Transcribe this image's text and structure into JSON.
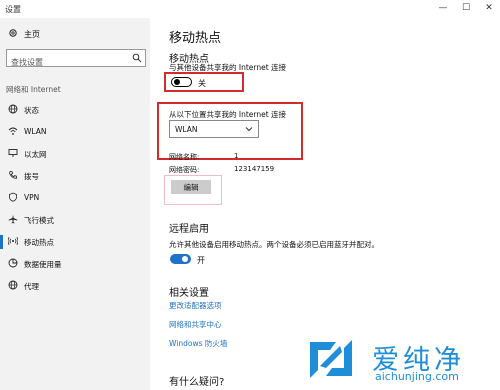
{
  "window": {
    "title": "设置",
    "controls": {
      "minimize": "—",
      "maximize": "☐",
      "close": "✕"
    }
  },
  "sidebar": {
    "home_label": "主页",
    "search_placeholder": "查找设置",
    "section_title": "网络和 Internet",
    "items": [
      {
        "label": "状态",
        "icon": "globe-icon"
      },
      {
        "label": "WLAN",
        "icon": "wifi-icon"
      },
      {
        "label": "以太网",
        "icon": "ethernet-icon"
      },
      {
        "label": "拨号",
        "icon": "phone-icon"
      },
      {
        "label": "VPN",
        "icon": "vpn-icon"
      },
      {
        "label": "飞行模式",
        "icon": "airplane-icon"
      },
      {
        "label": "移动热点",
        "icon": "hotspot-icon",
        "active": true
      },
      {
        "label": "数据使用量",
        "icon": "data-usage-icon"
      },
      {
        "label": "代理",
        "icon": "proxy-icon"
      }
    ]
  },
  "main": {
    "page_title": "移动热点",
    "hotspot": {
      "title": "移动热点",
      "desc": "与其他设备共享我的 Internet 连接",
      "toggle_state": "关",
      "toggle_on": false
    },
    "share_from": {
      "label": "从以下位置共享我的 Internet 连接",
      "selected": "WLAN"
    },
    "network_name_label": "网络名称:",
    "network_name_value": "1",
    "network_password_label": "网络密码:",
    "network_password_value": "123147159",
    "edit_label": "编辑",
    "remote": {
      "title": "远程启用",
      "desc": "允许其他设备启用移动热点。两个设备必须已启用蓝牙并配对。",
      "toggle_state": "开",
      "toggle_on": true
    },
    "related": {
      "title": "相关设置",
      "links": [
        "更改适配器选项",
        "网络和共享中心",
        "Windows 防火墙"
      ]
    },
    "question_title": "有什么疑问?"
  },
  "watermark": {
    "text": "爱纯净",
    "url": "aichunjing.com"
  },
  "colors": {
    "accent": "#1f72c7",
    "highlight_box": "#d62b2b",
    "watermark": "#1f8ed8"
  }
}
